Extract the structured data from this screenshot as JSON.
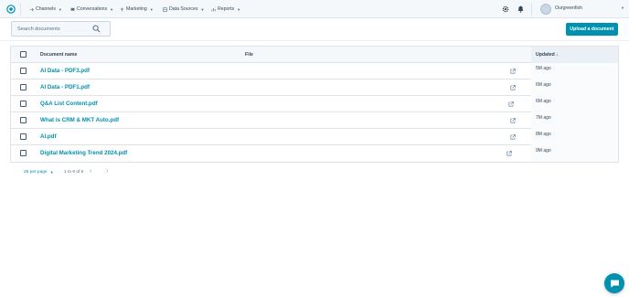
{
  "nav": {
    "items": [
      {
        "label": "Channels",
        "icon": "channels-icon"
      },
      {
        "label": "Conversations",
        "icon": "conversations-icon"
      },
      {
        "label": "Marketing",
        "icon": "marketing-icon"
      },
      {
        "label": "Data Sources",
        "icon": "data-sources-icon"
      },
      {
        "label": "Reports",
        "icon": "reports-icon"
      }
    ],
    "username": "Ourgreenfish"
  },
  "search": {
    "placeholder": "Search documents",
    "value": ""
  },
  "upload_label": "Upload a document",
  "table": {
    "headers": {
      "name": "Document name",
      "file": "File",
      "updated": "Updated ↓"
    },
    "rows": [
      {
        "name": "AI Data - PDF3.pdf",
        "updated": "5M ago"
      },
      {
        "name": "AI Data - PDF1.pdf",
        "updated": "6M ago"
      },
      {
        "name": "Q&A List Content.pdf",
        "updated": "6M ago"
      },
      {
        "name": "What is CRM & MKT Auto.pdf",
        "updated": "7M ago"
      },
      {
        "name": "AI.pdf",
        "updated": "8M ago"
      },
      {
        "name": "Digital Marketing Trend 2024.pdf",
        "updated": "9M ago"
      }
    ]
  },
  "pagination": {
    "per_page": "25 per page",
    "count": "1 to 6 of 6"
  },
  "colors": {
    "accent": "#0091ae",
    "text": "#33475b",
    "nav_bg": "#f5f8fa"
  }
}
